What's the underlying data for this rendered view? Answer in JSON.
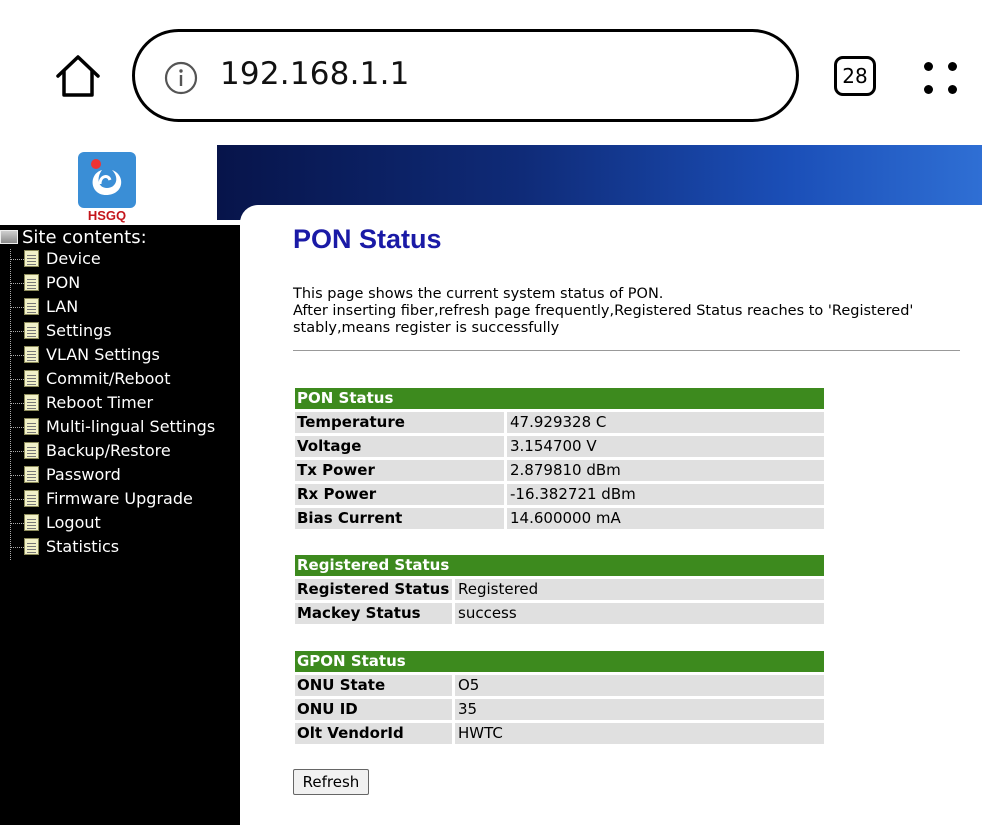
{
  "browser": {
    "url": "192.168.1.1",
    "tab_count": "28"
  },
  "logo": {
    "text": "HSGQ"
  },
  "sidebar": {
    "title": "Site contents:",
    "items": [
      {
        "label": "Device"
      },
      {
        "label": "PON"
      },
      {
        "label": "LAN"
      },
      {
        "label": "Settings"
      },
      {
        "label": "VLAN Settings"
      },
      {
        "label": "Commit/Reboot"
      },
      {
        "label": "Reboot Timer"
      },
      {
        "label": "Multi-lingual Settings"
      },
      {
        "label": "Backup/Restore"
      },
      {
        "label": "Password"
      },
      {
        "label": "Firmware Upgrade"
      },
      {
        "label": "Logout"
      },
      {
        "label": "Statistics"
      }
    ]
  },
  "main": {
    "title": "PON Status",
    "desc_line1": "This page shows the current system status of PON.",
    "desc_line2": "After inserting fiber,refresh page frequently,Registered Status reaches to 'Registered' stably,means register is successfully",
    "pon_status": {
      "header": "PON Status",
      "rows": [
        {
          "label": "Temperature",
          "value": "47.929328 C"
        },
        {
          "label": "Voltage",
          "value": "3.154700 V"
        },
        {
          "label": "Tx Power",
          "value": "2.879810 dBm"
        },
        {
          "label": "Rx Power",
          "value": "-16.382721 dBm"
        },
        {
          "label": "Bias Current",
          "value": "14.600000 mA"
        }
      ]
    },
    "registered_status": {
      "header": "Registered Status",
      "rows": [
        {
          "label": "Registered Status",
          "value": "Registered"
        },
        {
          "label": "Mackey Status",
          "value": "success"
        }
      ]
    },
    "gpon_status": {
      "header": "GPON Status",
      "rows": [
        {
          "label": "ONU State",
          "value": "O5"
        },
        {
          "label": "ONU ID",
          "value": "35"
        },
        {
          "label": "Olt VendorId",
          "value": "HWTC"
        }
      ]
    },
    "refresh_label": "Refresh"
  },
  "colors": {
    "table_header": "#3d8a1e",
    "title_blue": "#1a1aa6",
    "row_bg": "#e0e0e0"
  }
}
